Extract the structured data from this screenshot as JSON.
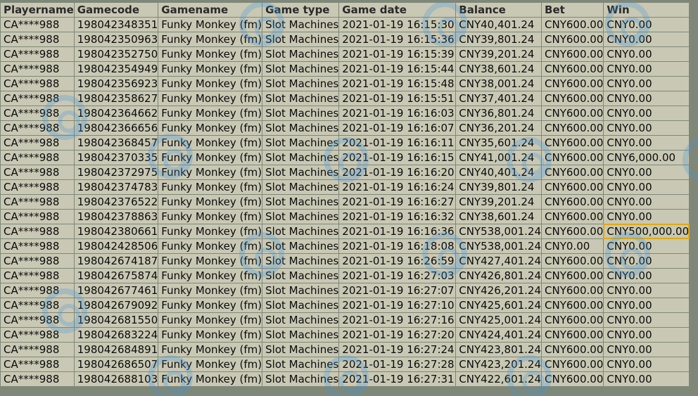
{
  "columns": [
    "Playername",
    "Gamecode",
    "Gamename",
    "Game type",
    "Game date",
    "Balance",
    "Bet",
    "Win"
  ],
  "highlight": {
    "row": 15,
    "col": 7,
    "color": "#e0a90f"
  },
  "watermark": {
    "icon": "casino-logo-icon",
    "color": "#4696d7"
  },
  "rows": [
    [
      "CA****988",
      "198042348351",
      "Funky Monkey (fm)",
      "Slot Machines",
      "2021-01-19 16:15:30",
      "CNY40,401.24",
      "CNY600.00",
      "CNY0.00"
    ],
    [
      "CA****988",
      "198042350963",
      "Funky Monkey (fm)",
      "Slot Machines",
      "2021-01-19 16:15:36",
      "CNY39,801.24",
      "CNY600.00",
      "CNY0.00"
    ],
    [
      "CA****988",
      "198042352750",
      "Funky Monkey (fm)",
      "Slot Machines",
      "2021-01-19 16:15:39",
      "CNY39,201.24",
      "CNY600.00",
      "CNY0.00"
    ],
    [
      "CA****988",
      "198042354949",
      "Funky Monkey (fm)",
      "Slot Machines",
      "2021-01-19 16:15:44",
      "CNY38,601.24",
      "CNY600.00",
      "CNY0.00"
    ],
    [
      "CA****988",
      "198042356923",
      "Funky Monkey (fm)",
      "Slot Machines",
      "2021-01-19 16:15:48",
      "CNY38,001.24",
      "CNY600.00",
      "CNY0.00"
    ],
    [
      "CA****988",
      "198042358627",
      "Funky Monkey (fm)",
      "Slot Machines",
      "2021-01-19 16:15:51",
      "CNY37,401.24",
      "CNY600.00",
      "CNY0.00"
    ],
    [
      "CA****988",
      "198042364662",
      "Funky Monkey (fm)",
      "Slot Machines",
      "2021-01-19 16:16:03",
      "CNY36,801.24",
      "CNY600.00",
      "CNY0.00"
    ],
    [
      "CA****988",
      "198042366656",
      "Funky Monkey (fm)",
      "Slot Machines",
      "2021-01-19 16:16:07",
      "CNY36,201.24",
      "CNY600.00",
      "CNY0.00"
    ],
    [
      "CA****988",
      "198042368457",
      "Funky Monkey (fm)",
      "Slot Machines",
      "2021-01-19 16:16:11",
      "CNY35,601.24",
      "CNY600.00",
      "CNY0.00"
    ],
    [
      "CA****988",
      "198042370335",
      "Funky Monkey (fm)",
      "Slot Machines",
      "2021-01-19 16:16:15",
      "CNY41,001.24",
      "CNY600.00",
      "CNY6,000.00"
    ],
    [
      "CA****988",
      "198042372975",
      "Funky Monkey (fm)",
      "Slot Machines",
      "2021-01-19 16:16:20",
      "CNY40,401.24",
      "CNY600.00",
      "CNY0.00"
    ],
    [
      "CA****988",
      "198042374783",
      "Funky Monkey (fm)",
      "Slot Machines",
      "2021-01-19 16:16:24",
      "CNY39,801.24",
      "CNY600.00",
      "CNY0.00"
    ],
    [
      "CA****988",
      "198042376522",
      "Funky Monkey (fm)",
      "Slot Machines",
      "2021-01-19 16:16:27",
      "CNY39,201.24",
      "CNY600.00",
      "CNY0.00"
    ],
    [
      "CA****988",
      "198042378863",
      "Funky Monkey (fm)",
      "Slot Machines",
      "2021-01-19 16:16:32",
      "CNY38,601.24",
      "CNY600.00",
      "CNY0.00"
    ],
    [
      "CA****988",
      "198042380661",
      "Funky Monkey (fm)",
      "Slot Machines",
      "2021-01-19 16:16:36",
      "CNY538,001.24",
      "CNY600.00",
      "CNY500,000.00"
    ],
    [
      "CA****988",
      "198042428506",
      "Funky Monkey (fm)",
      "Slot Machines",
      "2021-01-19 16:18:08",
      "CNY538,001.24",
      "CNY0.00",
      "CNY0.00"
    ],
    [
      "CA****988",
      "198042674187",
      "Funky Monkey (fm)",
      "Slot Machines",
      "2021-01-19 16:26:59",
      "CNY427,401.24",
      "CNY600.00",
      "CNY0.00"
    ],
    [
      "CA****988",
      "198042675874",
      "Funky Monkey (fm)",
      "Slot Machines",
      "2021-01-19 16:27:03",
      "CNY426,801.24",
      "CNY600.00",
      "CNY0.00"
    ],
    [
      "CA****988",
      "198042677461",
      "Funky Monkey (fm)",
      "Slot Machines",
      "2021-01-19 16:27:07",
      "CNY426,201.24",
      "CNY600.00",
      "CNY0.00"
    ],
    [
      "CA****988",
      "198042679092",
      "Funky Monkey (fm)",
      "Slot Machines",
      "2021-01-19 16:27:10",
      "CNY425,601.24",
      "CNY600.00",
      "CNY0.00"
    ],
    [
      "CA****988",
      "198042681550",
      "Funky Monkey (fm)",
      "Slot Machines",
      "2021-01-19 16:27:16",
      "CNY425,001.24",
      "CNY600.00",
      "CNY0.00"
    ],
    [
      "CA****988",
      "198042683224",
      "Funky Monkey (fm)",
      "Slot Machines",
      "2021-01-19 16:27:20",
      "CNY424,401.24",
      "CNY600.00",
      "CNY0.00"
    ],
    [
      "CA****988",
      "198042684891",
      "Funky Monkey (fm)",
      "Slot Machines",
      "2021-01-19 16:27:24",
      "CNY423,801.24",
      "CNY600.00",
      "CNY0.00"
    ],
    [
      "CA****988",
      "198042686507",
      "Funky Monkey (fm)",
      "Slot Machines",
      "2021-01-19 16:27:28",
      "CNY423,201.24",
      "CNY600.00",
      "CNY0.00"
    ],
    [
      "CA****988",
      "198042688103",
      "Funky Monkey (fm)",
      "Slot Machines",
      "2021-01-19 16:27:31",
      "CNY422,601.24",
      "CNY600.00",
      "CNY0.00"
    ]
  ]
}
